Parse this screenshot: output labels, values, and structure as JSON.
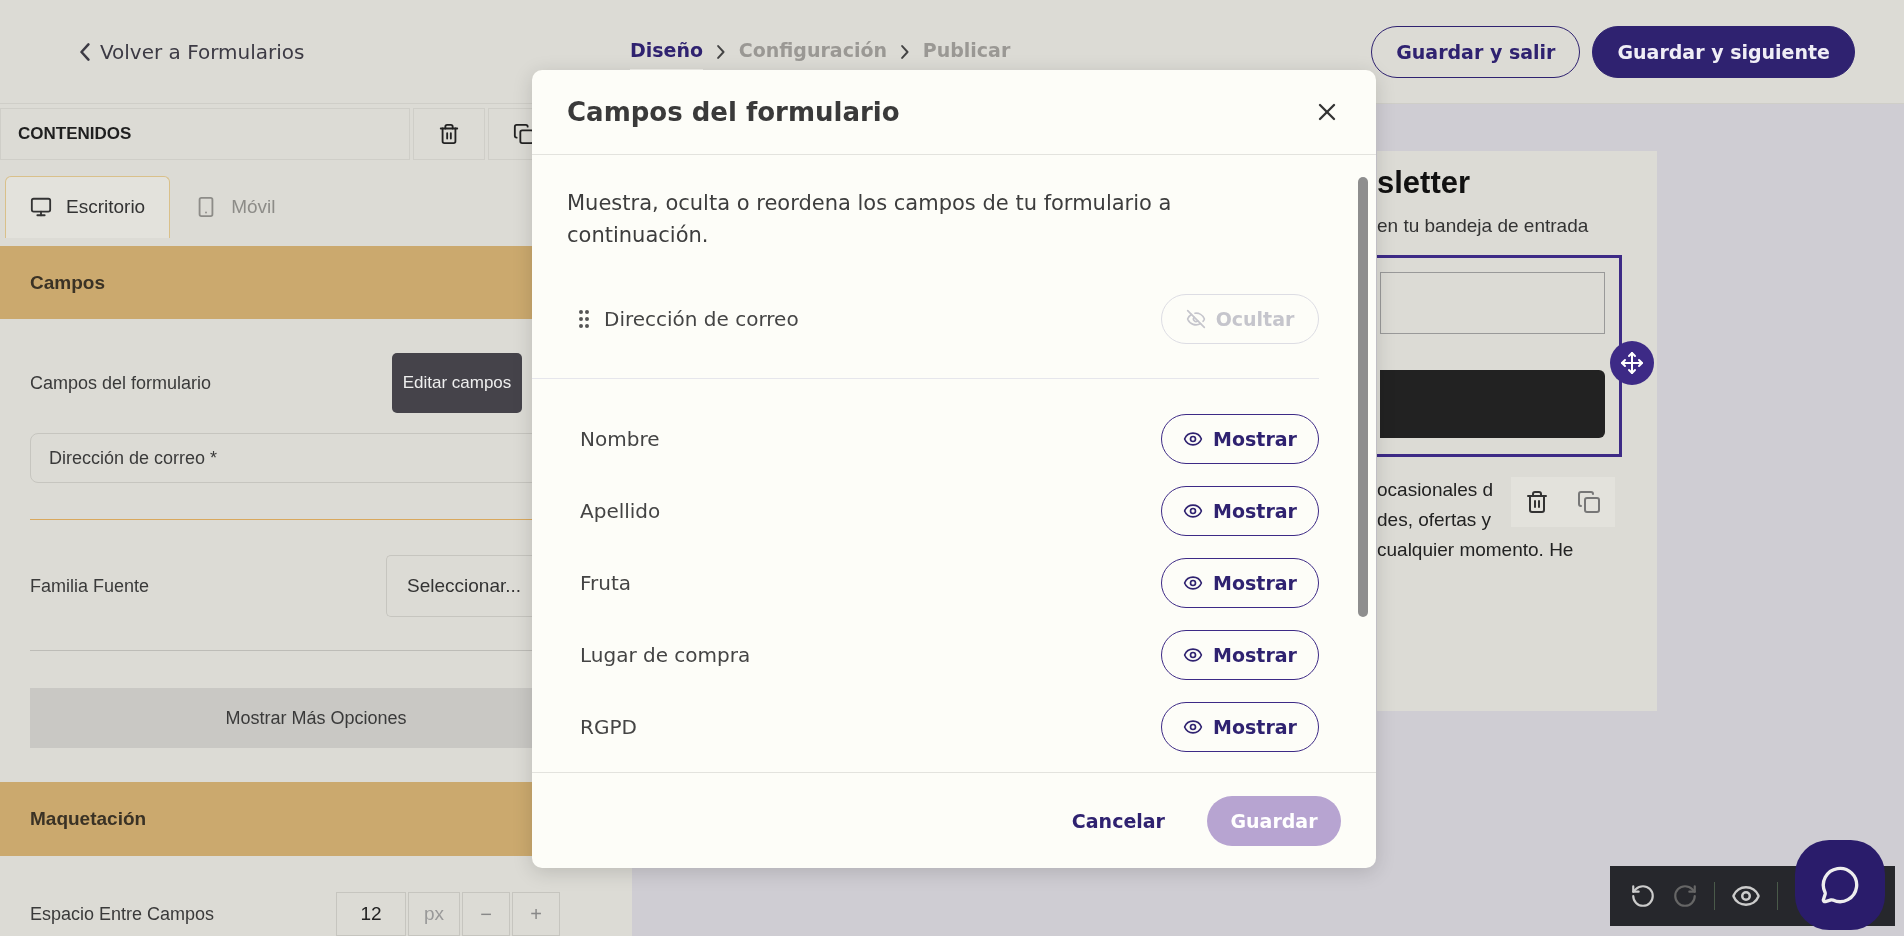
{
  "topbar": {
    "back_link": "Volver a Formularios",
    "steps": [
      {
        "label": "Diseño",
        "selected": true
      },
      {
        "label": "Configuración",
        "selected": false
      },
      {
        "label": "Publicar",
        "selected": false
      }
    ],
    "buttons": [
      {
        "label": "Guardar y salir",
        "kind": "outline"
      },
      {
        "label": "Guardar y siguiente",
        "kind": "primary"
      }
    ]
  },
  "sidebar": {
    "title": "CONTENIDOS",
    "tabs": [
      {
        "label": "Escritorio",
        "selected": true,
        "kind": "desktop"
      },
      {
        "label": "Móvil",
        "selected": false,
        "kind": "mobile"
      }
    ],
    "fields_section": {
      "title": "Campos",
      "form_fields_label": "Campos del formulario",
      "edit_button": "Editar campos",
      "field_value": "Dirección de correo *",
      "font_label": "Familia Fuente",
      "font_select": "Seleccionar...",
      "more_button": "Mostrar Más Opciones"
    },
    "layout_section": {
      "title": "Maquetación",
      "spacing_label": "Espacio Entre Campos",
      "spacing_value": "12",
      "spacing_unit": "px",
      "minus": "−",
      "plus": "+"
    }
  },
  "preview": {
    "title": "sletter",
    "subtitle": "en tu bandeja de entrada",
    "consent_lines": [
      "ocasionales d",
      "des, ofertas y",
      "cualquier momento. He"
    ]
  },
  "modal": {
    "title": "Campos del formulario",
    "description": "Muestra, oculta o reordena los campos de tu formulario a continuación.",
    "fields": [
      {
        "name": "Dirección de correo",
        "draggable": true,
        "visible": true,
        "action": "Ocultar",
        "disabled": true
      },
      {
        "name": "Nombre",
        "draggable": false,
        "visible": false,
        "action": "Mostrar",
        "disabled": false
      },
      {
        "name": "Apellido",
        "draggable": false,
        "visible": false,
        "action": "Mostrar",
        "disabled": false
      },
      {
        "name": "Fruta",
        "draggable": false,
        "visible": false,
        "action": "Mostrar",
        "disabled": false
      },
      {
        "name": "Lugar de compra",
        "draggable": false,
        "visible": false,
        "action": "Mostrar",
        "disabled": false
      },
      {
        "name": "RGPD",
        "draggable": false,
        "visible": false,
        "action": "Mostrar",
        "disabled": false
      }
    ],
    "cancel": "Cancelar",
    "save": {
      "label": "Guardar",
      "disabled": true
    }
  }
}
